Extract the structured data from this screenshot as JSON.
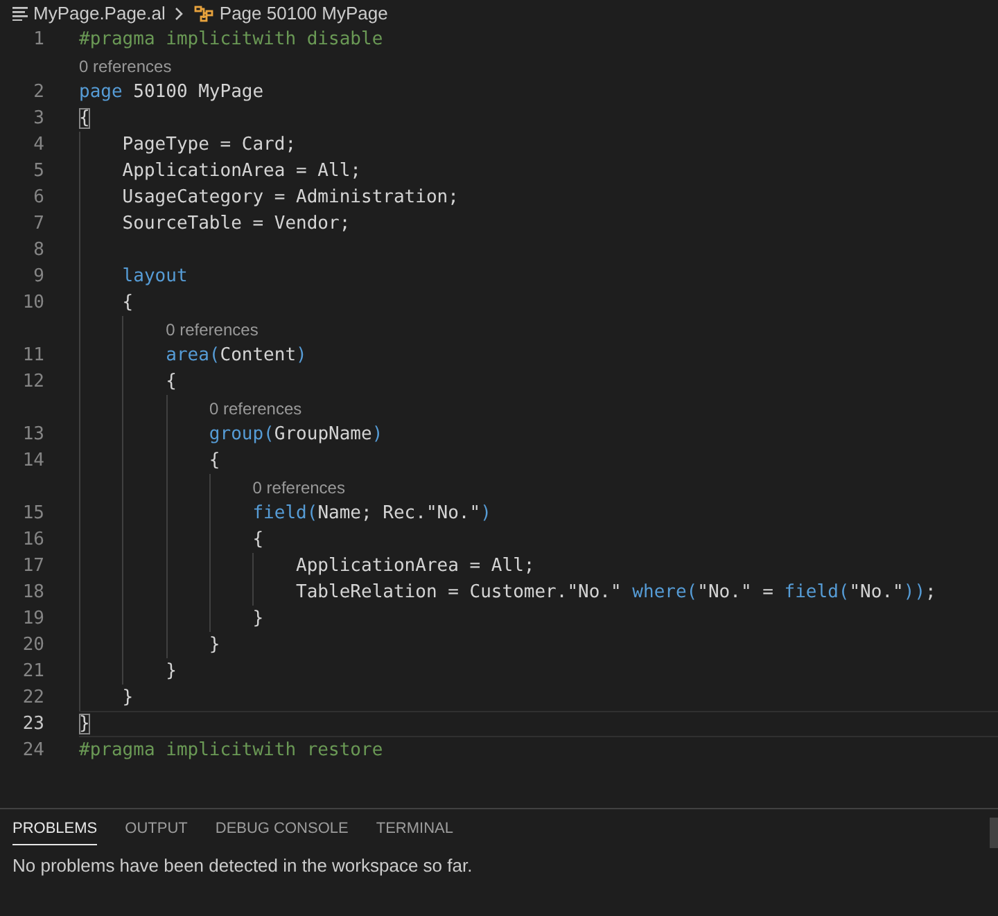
{
  "breadcrumb": {
    "file": "MyPage.Page.al",
    "symbol": "Page 50100 MyPage"
  },
  "lines": [
    {
      "number": "1",
      "tokens": [
        {
          "kind": "comment",
          "text": "#pragma implicitwith disable"
        }
      ]
    },
    {
      "number": "2",
      "codelens": "0 references",
      "tokens": [
        {
          "kind": "keyword",
          "text": "page"
        },
        {
          "kind": "plain",
          "text": " 50100 MyPage"
        }
      ]
    },
    {
      "number": "3",
      "tokens": [
        {
          "kind": "bracket",
          "text": "{"
        }
      ]
    },
    {
      "number": "4",
      "tokens": [
        {
          "kind": "plain",
          "text": "    PageType = Card;"
        }
      ]
    },
    {
      "number": "5",
      "tokens": [
        {
          "kind": "plain",
          "text": "    ApplicationArea = All;"
        }
      ]
    },
    {
      "number": "6",
      "tokens": [
        {
          "kind": "plain",
          "text": "    UsageCategory = Administration;"
        }
      ]
    },
    {
      "number": "7",
      "tokens": [
        {
          "kind": "plain",
          "text": "    SourceTable = Vendor;"
        }
      ]
    },
    {
      "number": "8"
    },
    {
      "number": "9",
      "tokens": [
        {
          "kind": "keyword",
          "text": "    layout"
        }
      ]
    },
    {
      "number": "10",
      "tokens": [
        {
          "kind": "plain",
          "text": "    {"
        }
      ]
    },
    {
      "number": "11",
      "codelens": "0 references",
      "tokens": [
        {
          "kind": "keyword",
          "text": "        area("
        },
        {
          "kind": "plain",
          "text": "Content"
        },
        {
          "kind": "keyword",
          "text": ")"
        }
      ]
    },
    {
      "number": "12",
      "tokens": [
        {
          "kind": "plain",
          "text": "        {"
        }
      ]
    },
    {
      "number": "13",
      "codelens": "0 references",
      "tokens": [
        {
          "kind": "keyword",
          "text": "            group("
        },
        {
          "kind": "plain",
          "text": "GroupName"
        },
        {
          "kind": "keyword",
          "text": ")"
        }
      ]
    },
    {
      "number": "14",
      "tokens": [
        {
          "kind": "plain",
          "text": "            {"
        }
      ]
    },
    {
      "number": "15",
      "codelens": "0 references",
      "tokens": [
        {
          "kind": "keyword",
          "text": "                field("
        },
        {
          "kind": "plain",
          "text": "Name; Rec.\"No.\""
        },
        {
          "kind": "keyword",
          "text": ")"
        }
      ]
    },
    {
      "number": "16",
      "tokens": [
        {
          "kind": "plain",
          "text": "                {"
        }
      ]
    },
    {
      "number": "17",
      "tokens": [
        {
          "kind": "plain",
          "text": "                    ApplicationArea = All;"
        }
      ]
    },
    {
      "number": "18",
      "tokens": [
        {
          "kind": "plain",
          "text": "                    TableRelation = Customer.\"No.\" "
        },
        {
          "kind": "keyword",
          "text": "where("
        },
        {
          "kind": "plain",
          "text": "\"No.\" = "
        },
        {
          "kind": "keyword",
          "text": "field("
        },
        {
          "kind": "plain",
          "text": "\"No.\""
        },
        {
          "kind": "keyword",
          "text": "))"
        },
        {
          "kind": "plain",
          "text": ";"
        }
      ]
    },
    {
      "number": "19",
      "tokens": [
        {
          "kind": "plain",
          "text": "                }"
        }
      ]
    },
    {
      "number": "20",
      "tokens": [
        {
          "kind": "plain",
          "text": "            }"
        }
      ]
    },
    {
      "number": "21",
      "tokens": [
        {
          "kind": "plain",
          "text": "        }"
        }
      ]
    },
    {
      "number": "22",
      "tokens": [
        {
          "kind": "plain",
          "text": "    }"
        }
      ]
    },
    {
      "number": "23",
      "current": true,
      "tokens": [
        {
          "kind": "bracket",
          "text": "}"
        }
      ]
    },
    {
      "number": "24",
      "tokens": [
        {
          "kind": "comment",
          "text": "#pragma implicitwith restore"
        }
      ]
    }
  ],
  "panel": {
    "tabs": [
      {
        "label": "PROBLEMS",
        "selected": true
      },
      {
        "label": "OUTPUT",
        "selected": false
      },
      {
        "label": "DEBUG CONSOLE",
        "selected": false
      },
      {
        "label": "TERMINAL",
        "selected": false
      }
    ],
    "message": "No problems have been detected in the workspace so far."
  }
}
